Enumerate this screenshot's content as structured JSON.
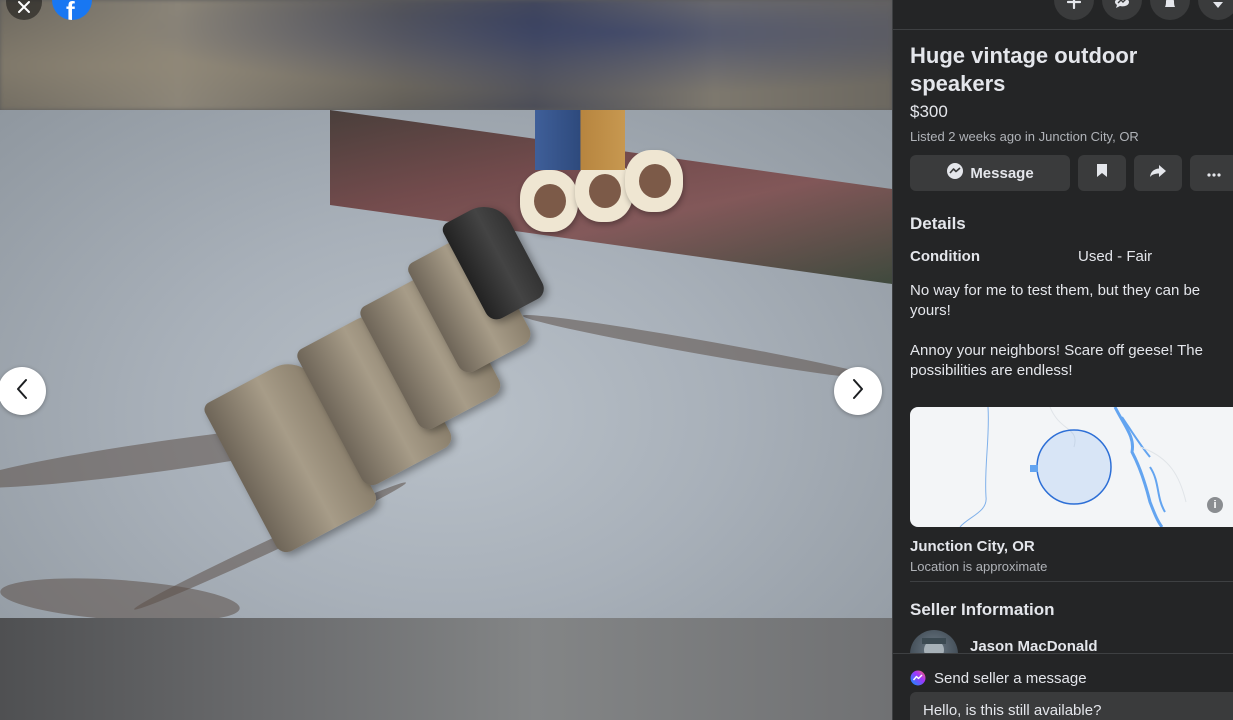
{
  "viewer": {
    "close_icon": "close-icon",
    "logo": {
      "letter": "f",
      "brand_color": "#1877f2"
    },
    "prev_icon": "chevron-left-icon",
    "next_icon": "chevron-right-icon"
  },
  "topbar": {
    "icons": [
      "plus-icon",
      "messenger-icon",
      "bell-icon",
      "caret-down-icon"
    ]
  },
  "listing": {
    "title": "Huge vintage outdoor speakers",
    "price": "$300",
    "listed": "Listed 2 weeks ago in Junction City, OR",
    "actions": {
      "message_label": "Message",
      "save_icon": "bookmark-icon",
      "share_icon": "share-icon",
      "more_icon": "more-icon"
    }
  },
  "details": {
    "heading": "Details",
    "condition_label": "Condition",
    "condition_value": "Used - Fair",
    "description": [
      "No way for me to test them, but they can be yours!",
      "Annoy your neighbors! Scare off geese! The possibilities are endless!"
    ]
  },
  "location": {
    "name": "Junction City, OR",
    "note": "Location is approximate",
    "map_info_icon": "info-icon"
  },
  "seller": {
    "heading": "Seller Information",
    "name": "Jason MacDonald"
  },
  "message_panel": {
    "label": "Send seller a message",
    "input_value": "Hello, is this still available?"
  },
  "colors": {
    "sidebar_bg": "#242526",
    "button_bg": "#3a3b3c",
    "text_primary": "#e4e6eb",
    "text_secondary": "#b0b3b8",
    "map_water": "#63a4f0"
  }
}
